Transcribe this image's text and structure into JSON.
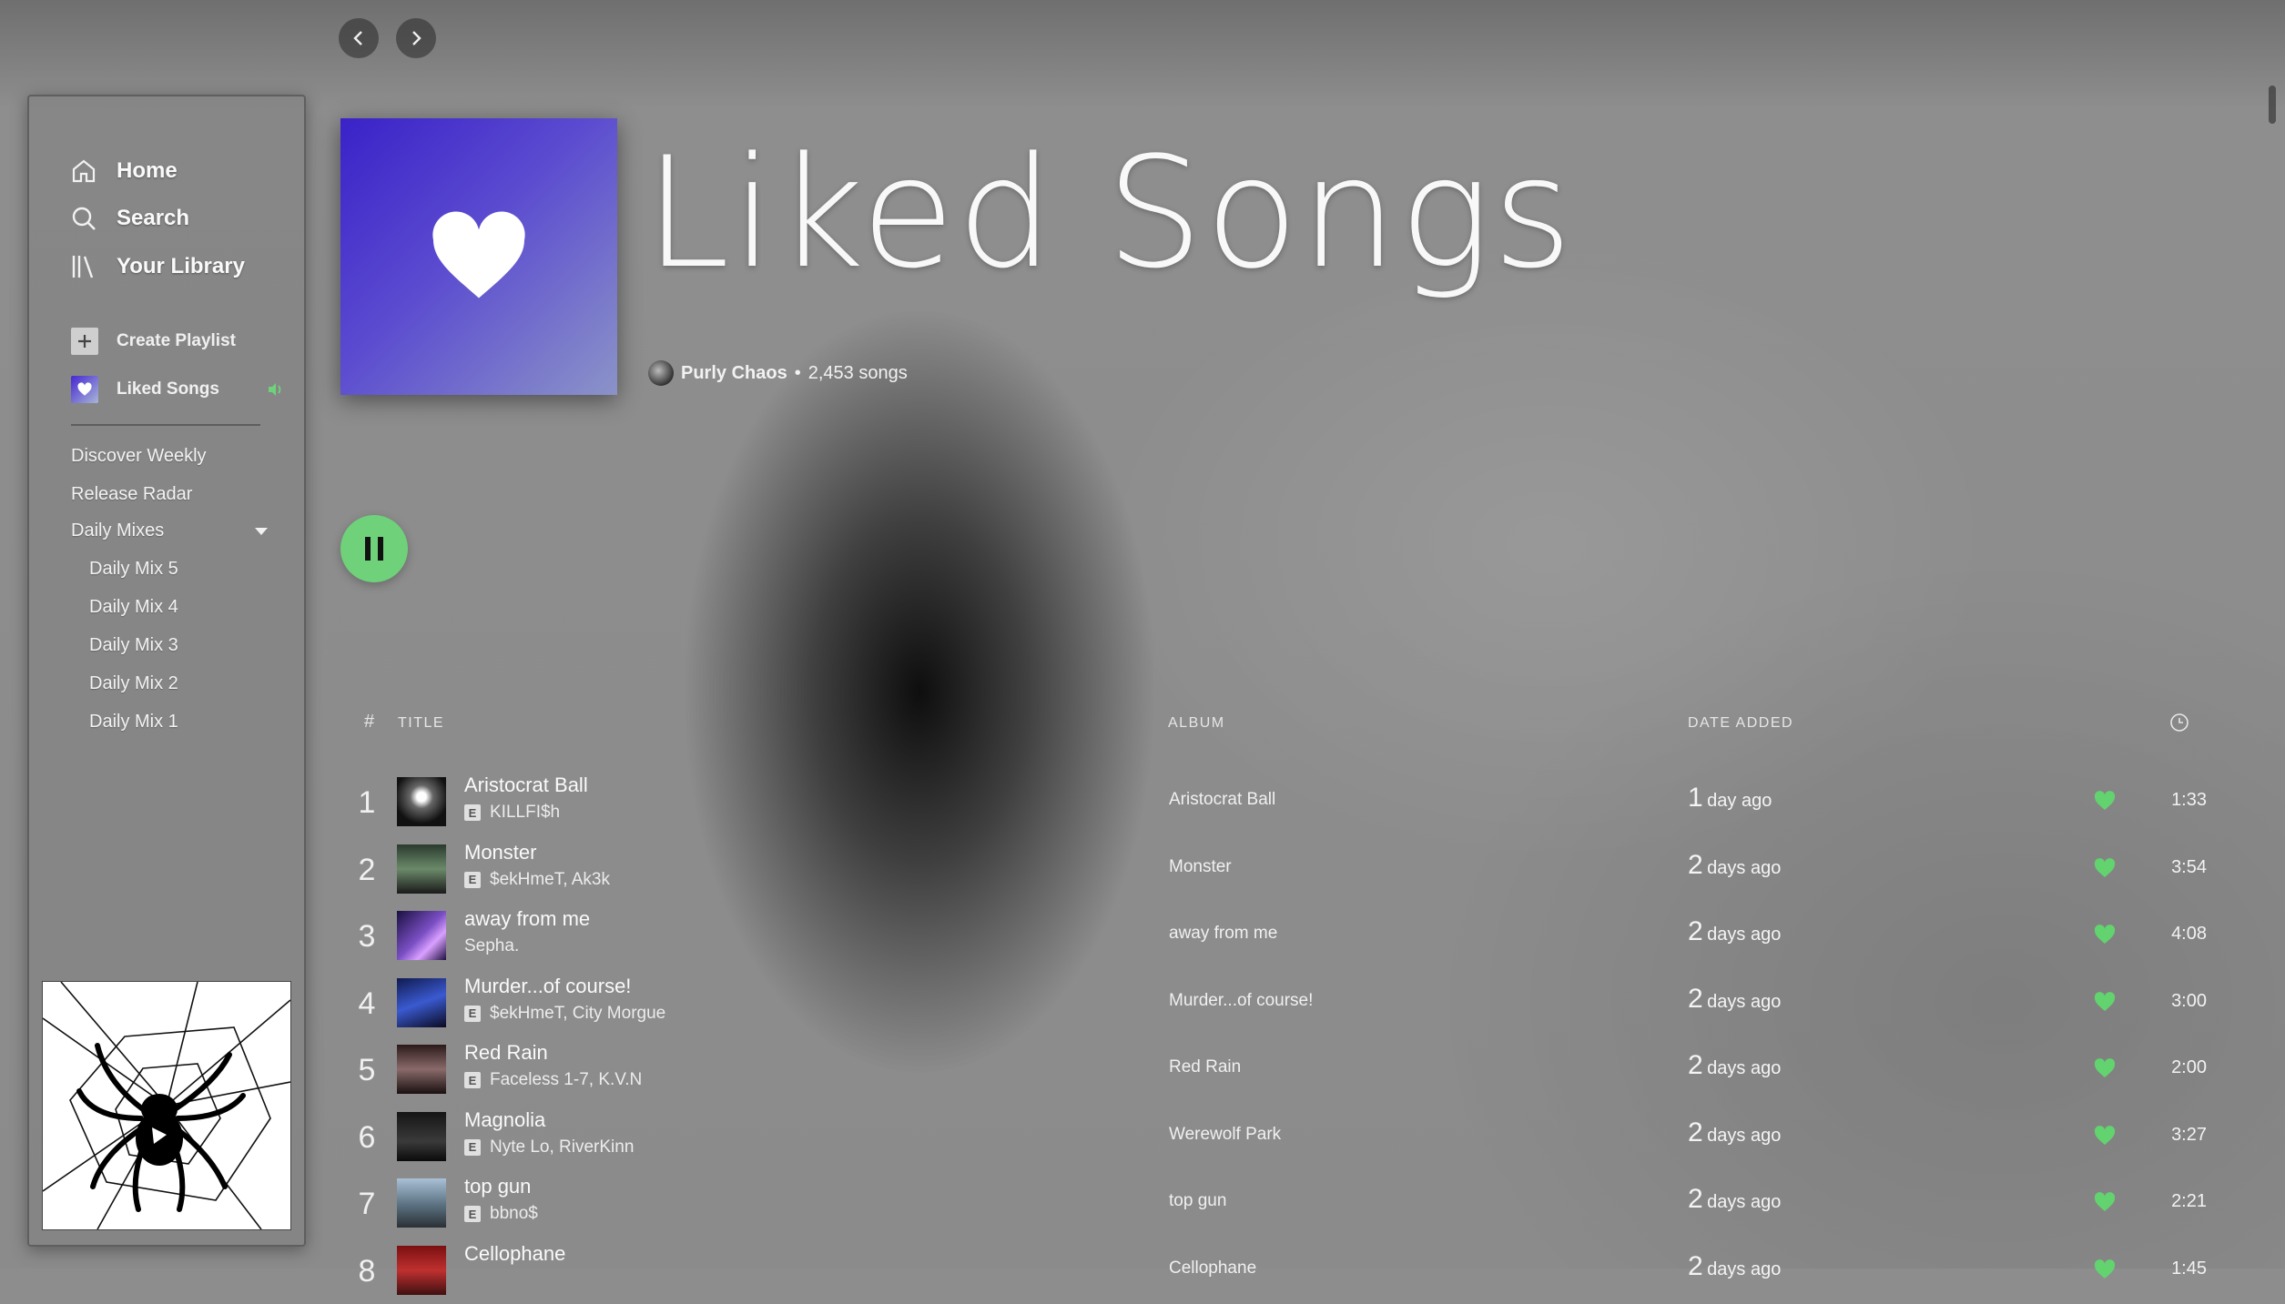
{
  "nav": {
    "back_label": "Go back",
    "forward_label": "Go forward"
  },
  "sidebar": {
    "main_items": [
      {
        "label": "Home",
        "icon": "home-icon"
      },
      {
        "label": "Search",
        "icon": "search-icon"
      },
      {
        "label": "Your Library",
        "icon": "library-icon"
      }
    ],
    "create_playlist": "Create Playlist",
    "liked_songs": "Liked Songs",
    "playlists": [
      "Discover Weekly",
      "Release Radar",
      "Daily Mixes"
    ],
    "daily_mixes": [
      "Daily Mix 5",
      "Daily Mix 4",
      "Daily Mix 3",
      "Daily Mix 2",
      "Daily Mix 1"
    ]
  },
  "header": {
    "title": "Liked Songs",
    "owner": "Purly Chaos",
    "separator": "•",
    "song_count": "2,453 songs"
  },
  "columns": {
    "index": "#",
    "title": "TITLE",
    "album": "ALBUM",
    "date_added": "DATE ADDED",
    "duration_icon": "clock-icon"
  },
  "tracks": [
    {
      "index": "1",
      "title": "Aristocrat Ball",
      "artist": "KILLFI$h",
      "explicit": true,
      "album": "Aristocrat Ball",
      "date_num": "1",
      "date_rest": "day ago",
      "duration": "1:33"
    },
    {
      "index": "2",
      "title": "Monster",
      "artist": "$ekHmeT, Ak3k",
      "explicit": true,
      "album": "Monster",
      "date_num": "2",
      "date_rest": "days ago",
      "duration": "3:54"
    },
    {
      "index": "3",
      "title": "away from me",
      "artist": "Sepha.",
      "explicit": false,
      "album": "away from me",
      "date_num": "2",
      "date_rest": "days ago",
      "duration": "4:08"
    },
    {
      "index": "4",
      "title": "Murder...of course!",
      "artist": "$ekHmeT, City Morgue",
      "explicit": true,
      "album": "Murder...of course!",
      "date_num": "2",
      "date_rest": "days ago",
      "duration": "3:00"
    },
    {
      "index": "5",
      "title": "Red Rain",
      "artist": "Faceless 1-7, K.V.N",
      "explicit": true,
      "album": "Red Rain",
      "date_num": "2",
      "date_rest": "days ago",
      "duration": "2:00"
    },
    {
      "index": "6",
      "title": "Magnolia",
      "artist": "Nyte Lo, RiverKinn",
      "explicit": true,
      "album": "Werewolf Park",
      "date_num": "2",
      "date_rest": "days ago",
      "duration": "3:27"
    },
    {
      "index": "7",
      "title": "top gun",
      "artist": "bbno$",
      "explicit": true,
      "album": "top gun",
      "date_num": "2",
      "date_rest": "days ago",
      "duration": "2:21"
    },
    {
      "index": "8",
      "title": "Cellophane",
      "artist": "",
      "explicit": false,
      "album": "Cellophane",
      "date_num": "2",
      "date_rest": "days ago",
      "duration": "1:45"
    }
  ],
  "explicit_badge": "E",
  "colors": {
    "accent": "#6fd17a",
    "heart": "#62d36e",
    "liked_art_start": "#3a22c8",
    "liked_art_end": "#8b93c8"
  }
}
